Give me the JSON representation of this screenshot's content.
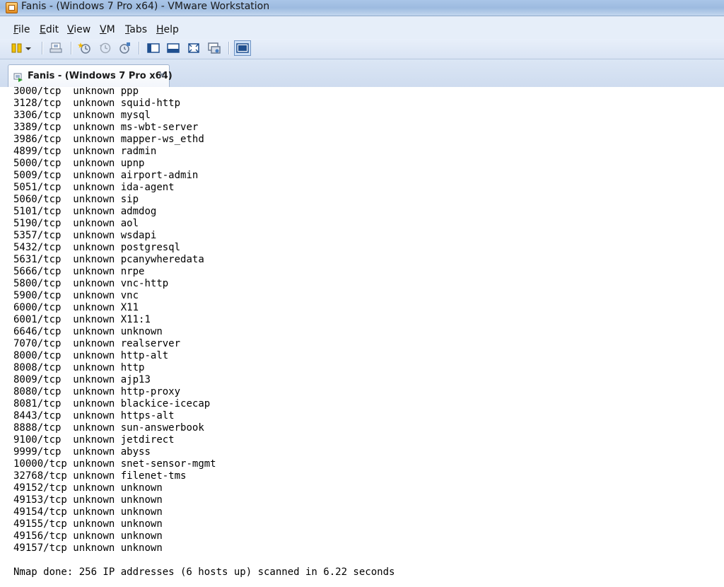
{
  "window": {
    "title": "Fanis - (Windows 7 Pro x64) - VMware Workstation"
  },
  "menu": {
    "items": [
      {
        "accel": "F",
        "rest": "ile"
      },
      {
        "accel": "E",
        "rest": "dit"
      },
      {
        "accel": "V",
        "rest": "iew"
      },
      {
        "accel": "V",
        "rest": "M"
      },
      {
        "accel": "T",
        "rest": "abs"
      },
      {
        "accel": "H",
        "rest": "elp"
      }
    ]
  },
  "toolbar": {
    "icons": [
      "power-pause-icon",
      "dropdown-arrow-icon",
      "send-ctrl-alt-del-icon",
      "take-snapshot-icon",
      "revert-snapshot-icon",
      "snapshot-manager-icon",
      "view-sidebar-icon",
      "view-console-icon",
      "full-screen-icon",
      "unity-icon",
      "console-view-active-icon"
    ]
  },
  "tab": {
    "label": "Fanis - (Windows 7 Pro x64)",
    "close": "×"
  },
  "console": {
    "lines": [
      {
        "port": "3000/tcp",
        "state": "unknown",
        "service": "ppp"
      },
      {
        "port": "3128/tcp",
        "state": "unknown",
        "service": "squid-http"
      },
      {
        "port": "3306/tcp",
        "state": "unknown",
        "service": "mysql"
      },
      {
        "port": "3389/tcp",
        "state": "unknown",
        "service": "ms-wbt-server"
      },
      {
        "port": "3986/tcp",
        "state": "unknown",
        "service": "mapper-ws_ethd"
      },
      {
        "port": "4899/tcp",
        "state": "unknown",
        "service": "radmin"
      },
      {
        "port": "5000/tcp",
        "state": "unknown",
        "service": "upnp"
      },
      {
        "port": "5009/tcp",
        "state": "unknown",
        "service": "airport-admin"
      },
      {
        "port": "5051/tcp",
        "state": "unknown",
        "service": "ida-agent"
      },
      {
        "port": "5060/tcp",
        "state": "unknown",
        "service": "sip"
      },
      {
        "port": "5101/tcp",
        "state": "unknown",
        "service": "admdog"
      },
      {
        "port": "5190/tcp",
        "state": "unknown",
        "service": "aol"
      },
      {
        "port": "5357/tcp",
        "state": "unknown",
        "service": "wsdapi"
      },
      {
        "port": "5432/tcp",
        "state": "unknown",
        "service": "postgresql"
      },
      {
        "port": "5631/tcp",
        "state": "unknown",
        "service": "pcanywheredata"
      },
      {
        "port": "5666/tcp",
        "state": "unknown",
        "service": "nrpe"
      },
      {
        "port": "5800/tcp",
        "state": "unknown",
        "service": "vnc-http"
      },
      {
        "port": "5900/tcp",
        "state": "unknown",
        "service": "vnc"
      },
      {
        "port": "6000/tcp",
        "state": "unknown",
        "service": "X11"
      },
      {
        "port": "6001/tcp",
        "state": "unknown",
        "service": "X11:1"
      },
      {
        "port": "6646/tcp",
        "state": "unknown",
        "service": "unknown"
      },
      {
        "port": "7070/tcp",
        "state": "unknown",
        "service": "realserver"
      },
      {
        "port": "8000/tcp",
        "state": "unknown",
        "service": "http-alt"
      },
      {
        "port": "8008/tcp",
        "state": "unknown",
        "service": "http"
      },
      {
        "port": "8009/tcp",
        "state": "unknown",
        "service": "ajp13"
      },
      {
        "port": "8080/tcp",
        "state": "unknown",
        "service": "http-proxy"
      },
      {
        "port": "8081/tcp",
        "state": "unknown",
        "service": "blackice-icecap"
      },
      {
        "port": "8443/tcp",
        "state": "unknown",
        "service": "https-alt"
      },
      {
        "port": "8888/tcp",
        "state": "unknown",
        "service": "sun-answerbook"
      },
      {
        "port": "9100/tcp",
        "state": "unknown",
        "service": "jetdirect"
      },
      {
        "port": "9999/tcp",
        "state": "unknown",
        "service": "abyss"
      },
      {
        "port": "10000/tcp",
        "state": "unknown",
        "service": "snet-sensor-mgmt"
      },
      {
        "port": "32768/tcp",
        "state": "unknown",
        "service": "filenet-tms"
      },
      {
        "port": "49152/tcp",
        "state": "unknown",
        "service": "unknown"
      },
      {
        "port": "49153/tcp",
        "state": "unknown",
        "service": "unknown"
      },
      {
        "port": "49154/tcp",
        "state": "unknown",
        "service": "unknown"
      },
      {
        "port": "49155/tcp",
        "state": "unknown",
        "service": "unknown"
      },
      {
        "port": "49156/tcp",
        "state": "unknown",
        "service": "unknown"
      },
      {
        "port": "49157/tcp",
        "state": "unknown",
        "service": "unknown"
      }
    ],
    "summary": "Nmap done: 256 IP addresses (6 hosts up) scanned in 6.22 seconds"
  }
}
